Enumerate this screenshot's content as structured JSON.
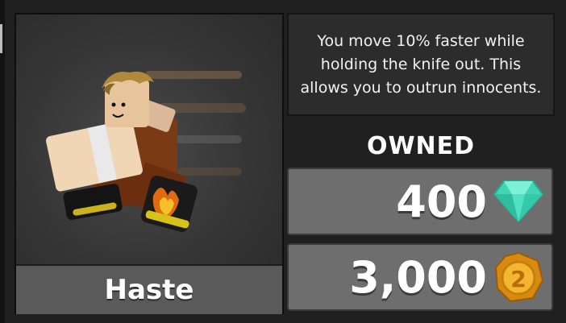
{
  "item": {
    "name": "Haste",
    "description": "You move 10% faster while holding the knife out. This allows you to outrun innocents.",
    "status": "OWNED"
  },
  "prices": [
    {
      "value": "400",
      "currency_icon": "gem-icon",
      "color": "#3fd6b6"
    },
    {
      "value": "3,000",
      "currency_icon": "coin-icon",
      "color": "#e8a21e"
    }
  ],
  "colors": {
    "background": "#202020",
    "panel": "#2c2c2c",
    "price_row": "#6e6e6e",
    "name_bar": "#5a5a5a"
  }
}
